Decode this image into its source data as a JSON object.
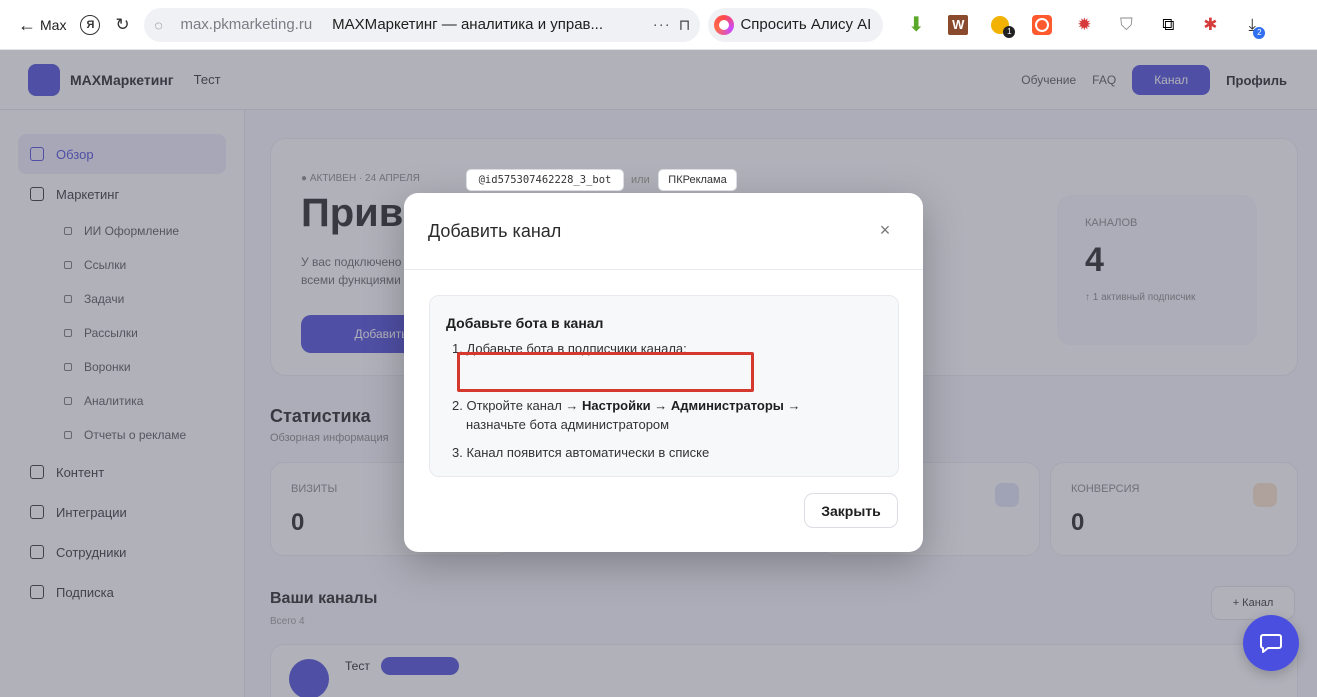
{
  "browser": {
    "back_label": "Max",
    "domain": "max.pkmarketing.ru",
    "page_title": "MAXМаркетинг — аналитика и управ...",
    "more": "···",
    "alice_label": "Спросить Алису AI",
    "ext_badge_coin": "1",
    "ext_badge_downloads": "2"
  },
  "app": {
    "logo_text": "MAXМаркетинг",
    "project_selector": "Тест",
    "header_links": [
      "Обучение",
      "FAQ"
    ],
    "header_button": "Канал",
    "profile_label": "Профиль",
    "sidebar": {
      "items": [
        {
          "label": "Обзор",
          "active": true
        },
        {
          "label": "Маркетинг",
          "active": false
        }
      ],
      "sub_items": [
        "ИИ Оформление",
        "Ссылки",
        "Задачи",
        "Рассылки",
        "Воронки",
        "Аналитика",
        "Отчеты о рекламе"
      ],
      "bottom_items": [
        "Контент",
        "Интеграции",
        "Сотрудники",
        "Подписка"
      ]
    },
    "welcome": {
      "crumbs": "● АКТИВЕН · 24 АПРЕЛЯ",
      "heading": "Привет",
      "para": "У вас подключено несколько каналов, продолжайте работу над всеми функциями",
      "cta": "Добавить",
      "stat_label": "КАНАЛОВ",
      "stat_value": "4",
      "stat_sub": "↑ 1 активный подписчик"
    },
    "stats_title": "Статистика",
    "stats_sub": "Обзорная информация",
    "kpis": [
      {
        "label": "ВИЗИТЫ",
        "value": "0"
      },
      {
        "label": "КОНВЕРСИЯ",
        "value": "0"
      }
    ],
    "channels_title": "Ваши каналы",
    "channels_sub": "Всего 4",
    "add_channel_btn": "+ Канал",
    "channel_row_name": "Тест"
  },
  "modal": {
    "title": "Добавить канал",
    "close_icon": "×",
    "heading": "Добавьте бота в канал",
    "step1": "1. Добавьте бота в подписчики канала:",
    "bot_username": "@id575307462228_3_bot",
    "or_text": "или",
    "bot_name": "ПКРеклама",
    "step2_prefix": "2. Откройте канал → ",
    "step2_settings": "Настройки",
    "step2_arrow": " → ",
    "step2_admins": "Администраторы",
    "step2_suffix": " →",
    "step2_line2": "назначьте бота администратором",
    "step3": "3. Канал появится автоматически в списке",
    "close_button": "Закрыть"
  },
  "colors": {
    "accent": "#4a4ad8",
    "highlight_frame": "#d5382c",
    "chat_fab": "#4b4fe0"
  }
}
